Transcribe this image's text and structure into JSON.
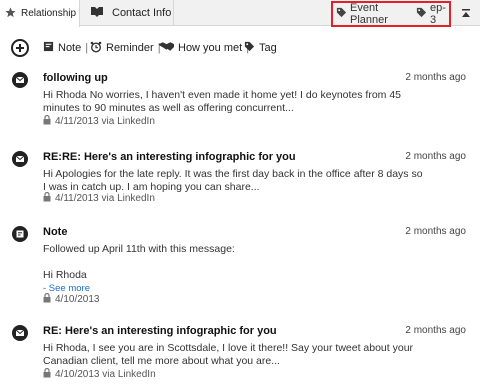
{
  "tabs": [
    {
      "label": "Relationship",
      "active": true
    },
    {
      "label": "Contact Info",
      "active": false
    }
  ],
  "tags": [
    "Event Planner",
    "ep-3"
  ],
  "colors": {
    "highlight_border": "#e0202a",
    "link": "#1a6fc9",
    "tab_bar_bg": "#f1f1f1"
  },
  "actions": {
    "note": "Note",
    "reminder": "Reminder",
    "how_you_met": "How you met",
    "tag": "Tag",
    "separator": "|"
  },
  "feed": [
    {
      "type": "message",
      "title": "following up",
      "time": "2 months ago",
      "body": "Hi Rhoda No worries, I haven't even made it home yet! I do keynotes from 45 minutes to 90 minutes as well as offering concurrent...",
      "meta": "4/11/2013 via LinkedIn"
    },
    {
      "type": "message",
      "title": "RE:RE: Here's an interesting infographic for you",
      "time": "2 months ago",
      "body": "Hi Apologies for the late reply. It was the first day back in the office after 8 days so I was in catch up. I am hoping you can share...",
      "meta": "4/11/2013 via LinkedIn"
    },
    {
      "type": "note",
      "title": "Note",
      "time": "2 months ago",
      "line1": "Followed up April 11th with this message:",
      "line2": "Hi Rhoda",
      "see_more": "- See more",
      "meta": "4/10/2013"
    },
    {
      "type": "message",
      "title": "RE: Here's an interesting infographic for you",
      "time": "2 months ago",
      "body": "Hi Rhoda, I see you are in Scottsdale, I love it there!! Say your tweet about your Canadian client, tell me more about what you are...",
      "meta": "4/10/2013 via LinkedIn"
    }
  ]
}
